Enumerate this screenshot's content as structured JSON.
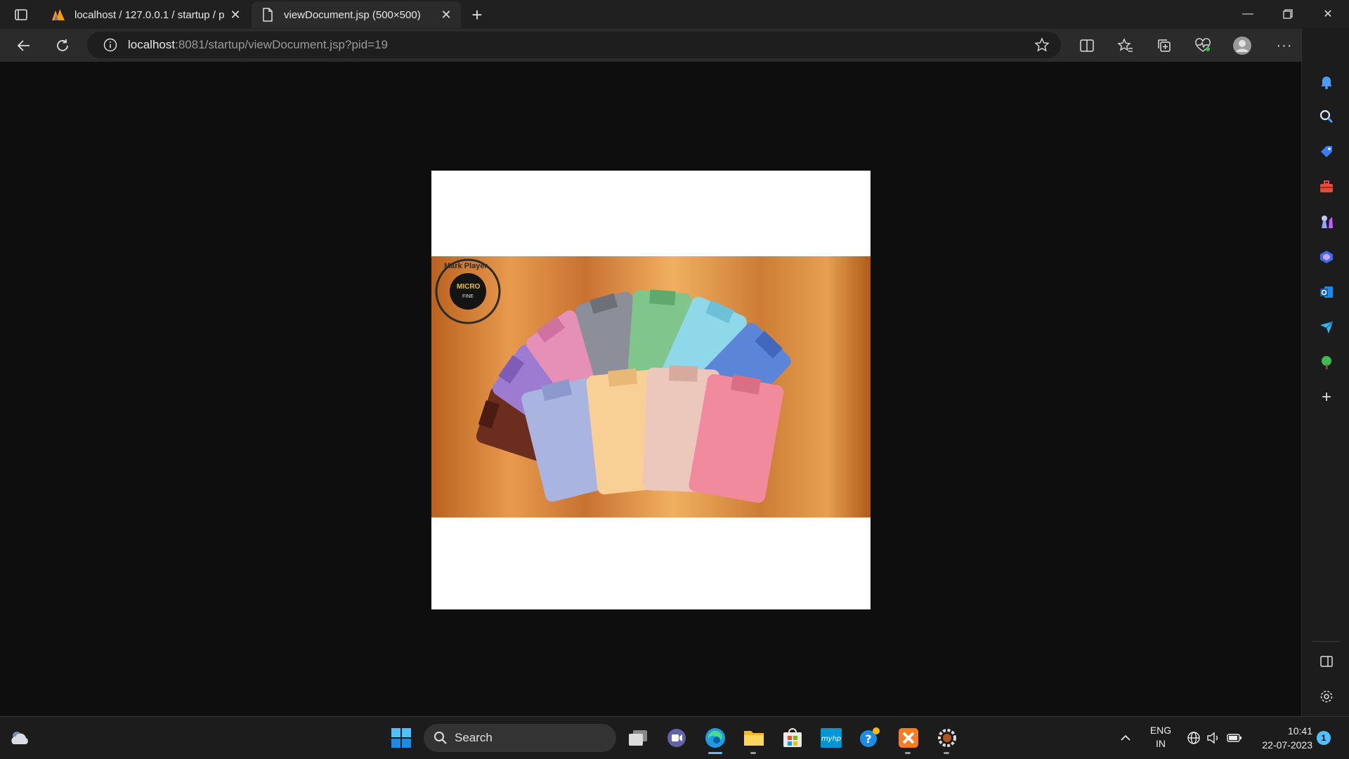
{
  "browser": {
    "tabs": [
      {
        "title": "localhost / 127.0.0.1 / startup / p",
        "favicon": "phpmyadmin-icon",
        "active": false
      },
      {
        "title": "viewDocument.jsp (500×500)",
        "favicon": "document-icon",
        "active": true
      }
    ],
    "address": {
      "host": "localhost",
      "rest": ":8081/startup/viewDocument.jsp?pid=19"
    }
  },
  "content": {
    "image_alt": "Colorful folded shirts fanned out on a wooden background",
    "badge_text": "Mark Player",
    "badge_brand": "MICRO",
    "badge_sub": "FINE"
  },
  "sidebar": {
    "icons": [
      "bell-icon",
      "search-icon",
      "tag-icon",
      "briefcase-icon",
      "chess-icon",
      "copilot-icon",
      "outlook-icon",
      "send-icon",
      "tree-icon",
      "plus-icon",
      "sidebar-panel-icon",
      "settings-icon"
    ]
  },
  "taskbar": {
    "search_label": "Search",
    "lang_line1": "ENG",
    "lang_line2": "IN",
    "time": "10:41",
    "date": "22-07-2023",
    "notifications": "1"
  },
  "colors": {
    "accent": "#4cc2ff",
    "windows_blue": "#0078d4"
  }
}
